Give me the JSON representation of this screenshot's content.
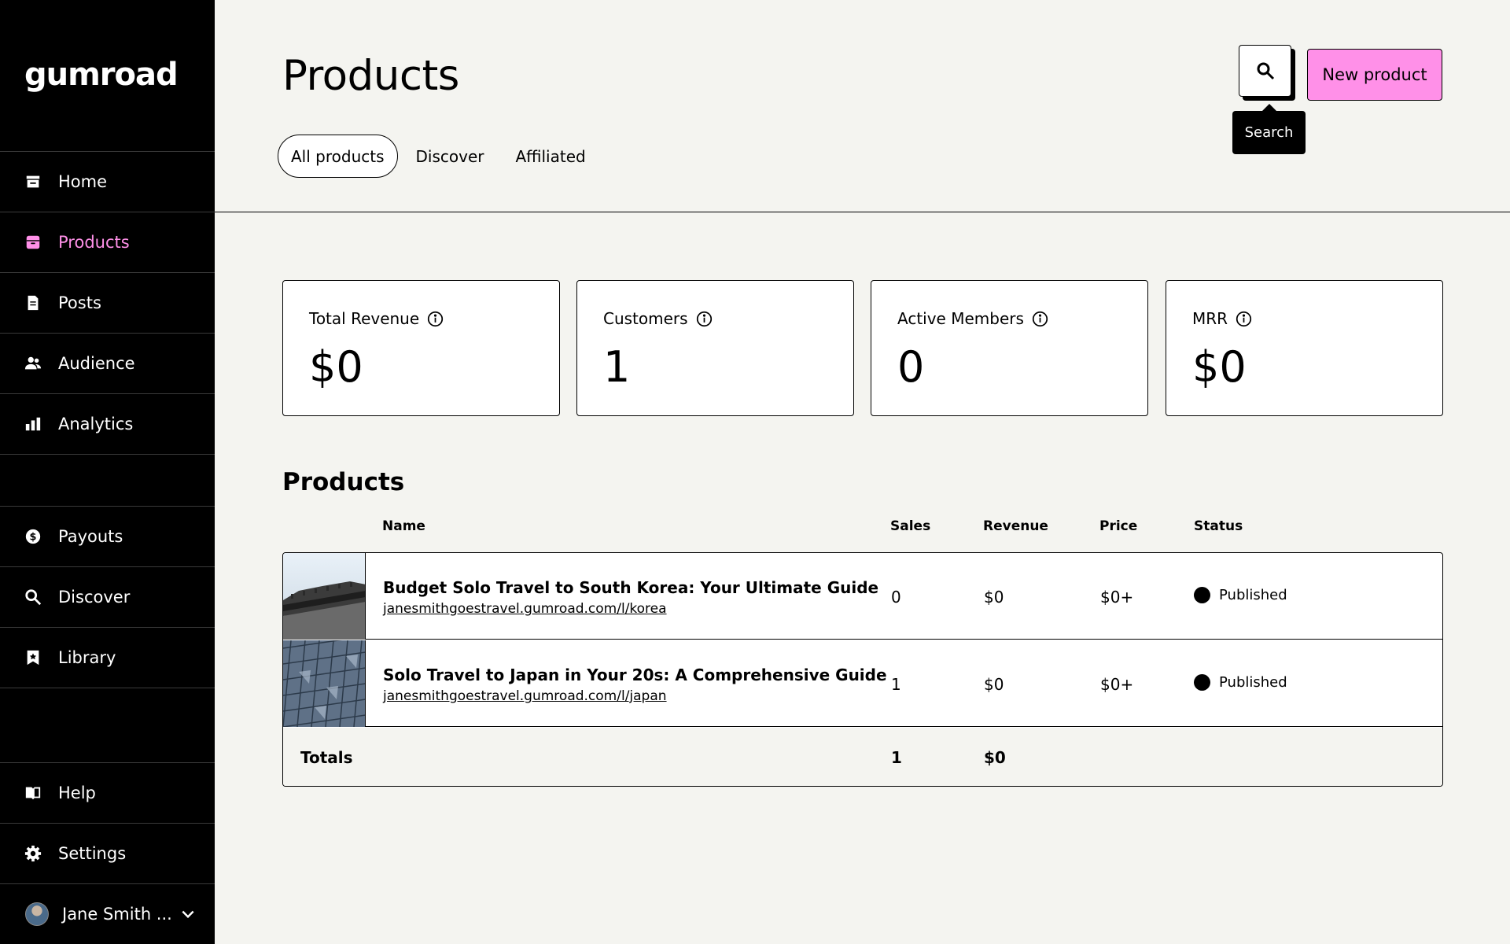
{
  "sidebar": {
    "logo": "gumroad",
    "items": [
      {
        "label": "Home",
        "icon": "store-icon"
      },
      {
        "label": "Products",
        "icon": "archive-icon"
      },
      {
        "label": "Posts",
        "icon": "document-icon"
      },
      {
        "label": "Audience",
        "icon": "people-icon"
      },
      {
        "label": "Analytics",
        "icon": "bar-chart-icon"
      },
      {
        "label": "Payouts",
        "icon": "dollar-icon"
      },
      {
        "label": "Discover",
        "icon": "search-icon"
      },
      {
        "label": "Library",
        "icon": "bookmark-icon"
      },
      {
        "label": "Help",
        "icon": "book-icon"
      },
      {
        "label": "Settings",
        "icon": "gear-icon"
      }
    ],
    "user": {
      "name": "Jane Smith ..."
    },
    "active_color": "#ff90e8"
  },
  "header": {
    "title": "Products",
    "tabs": [
      {
        "label": "All products"
      },
      {
        "label": "Discover"
      },
      {
        "label": "Affiliated"
      }
    ],
    "search_tooltip": "Search",
    "new_product_label": "New product",
    "accent_color": "#ff90e8"
  },
  "stats": [
    {
      "label": "Total Revenue",
      "value": "$0"
    },
    {
      "label": "Customers",
      "value": "1"
    },
    {
      "label": "Active Members",
      "value": "0"
    },
    {
      "label": "MRR",
      "value": "$0"
    }
  ],
  "products": {
    "title": "Products",
    "columns": {
      "name": "Name",
      "sales": "Sales",
      "revenue": "Revenue",
      "price": "Price",
      "status": "Status"
    },
    "rows": [
      {
        "name": "Budget Solo Travel to South Korea: Your Ultimate Guide",
        "url": "janesmithgoestravel.gumroad.com/l/korea",
        "sales": "0",
        "revenue": "$0",
        "price": "$0+",
        "status": "Published"
      },
      {
        "name": "Solo Travel to Japan in Your 20s: A Comprehensive Guide",
        "url": "janesmithgoestravel.gumroad.com/l/japan",
        "sales": "1",
        "revenue": "$0",
        "price": "$0+",
        "status": "Published"
      }
    ],
    "totals": {
      "label": "Totals",
      "sales": "1",
      "revenue": "$0"
    }
  }
}
